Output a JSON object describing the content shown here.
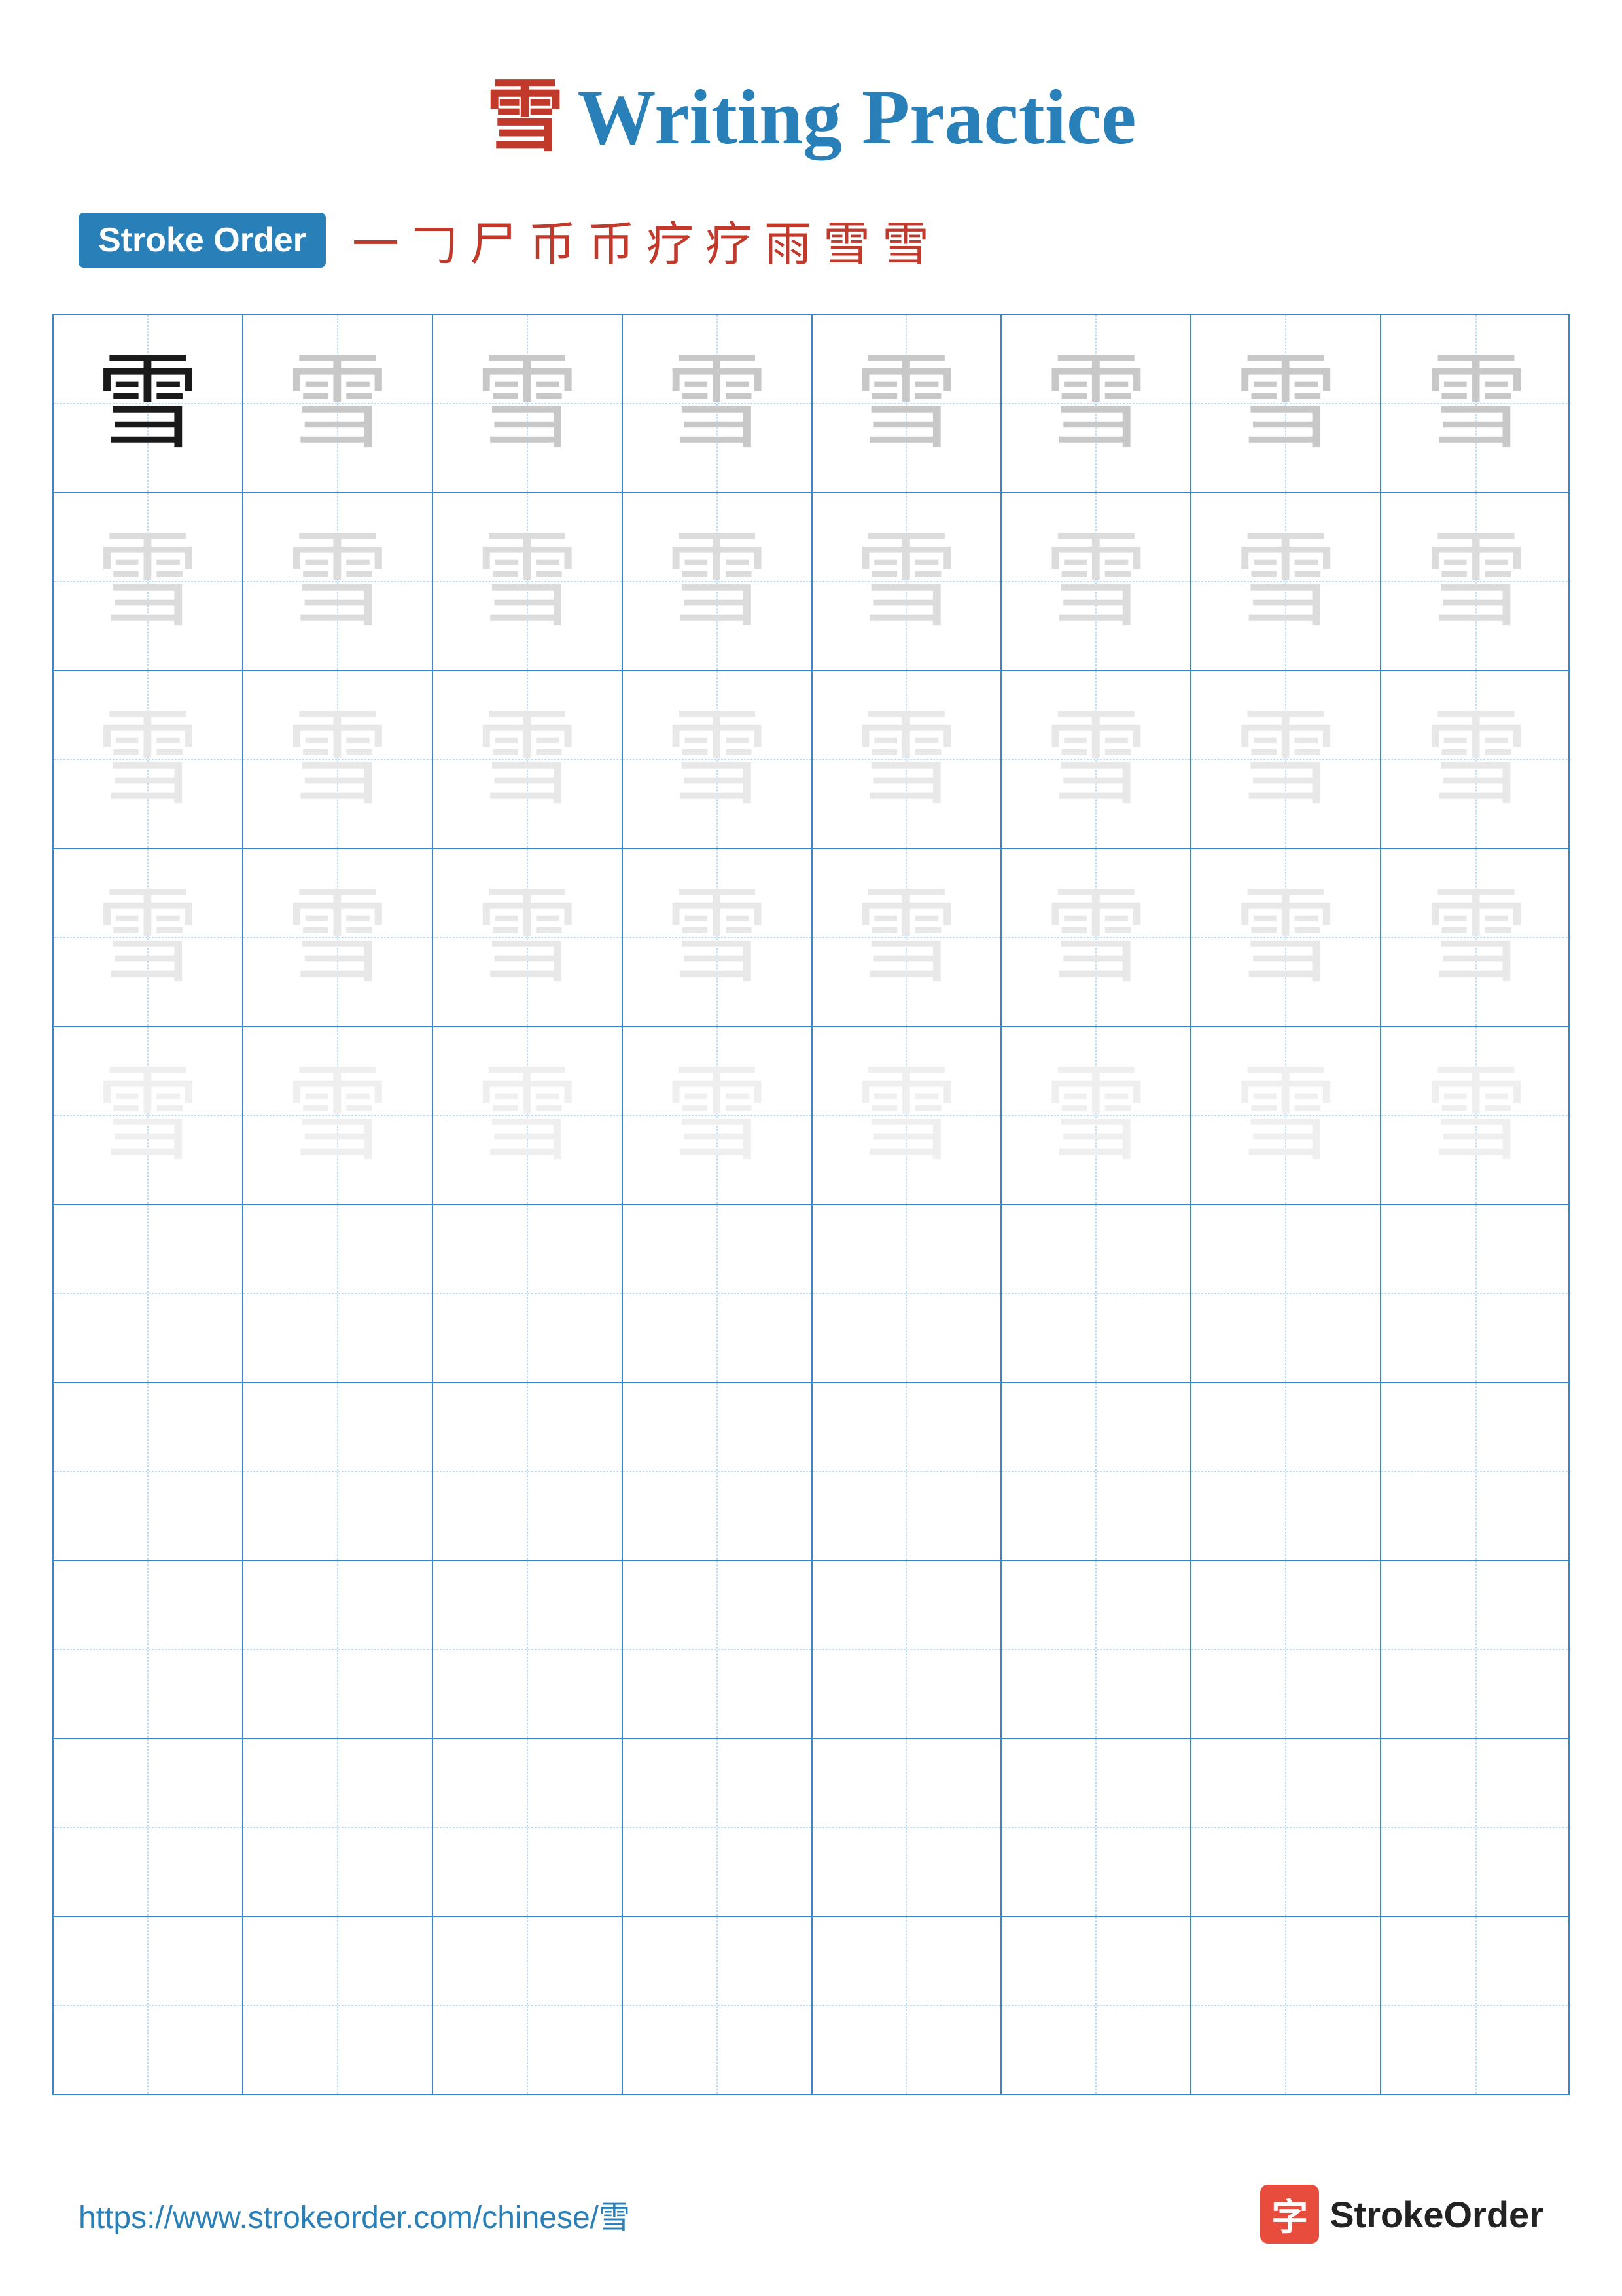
{
  "title": {
    "character": "雪",
    "text": "Writing Practice"
  },
  "strokeOrder": {
    "badge": "Stroke Order",
    "strokes": [
      "一",
      "𠃌",
      "尸",
      "币",
      "币",
      "疗",
      "疗",
      "雨",
      "雪",
      "雪"
    ]
  },
  "grid": {
    "rows": 10,
    "cols": 8,
    "character": "雪"
  },
  "footer": {
    "url": "https://www.strokeorder.com/chinese/雪",
    "logo_char": "字",
    "logo_text": "StrokeOrder"
  }
}
